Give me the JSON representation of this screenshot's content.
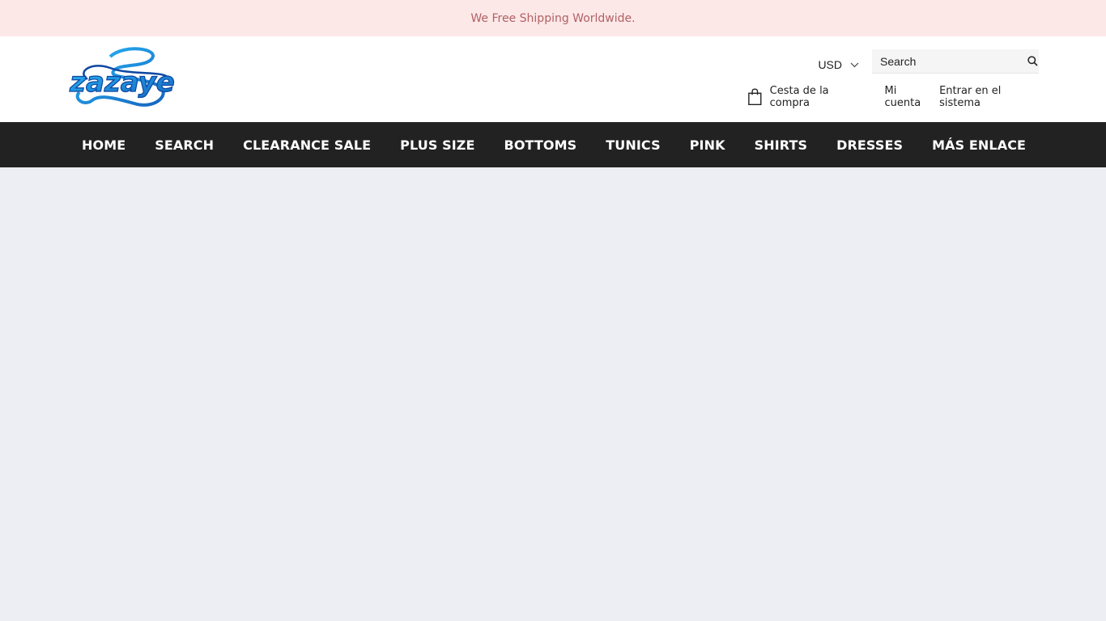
{
  "announcement": "We Free Shipping Worldwide.",
  "logo": {
    "alt": "Zazaye"
  },
  "header": {
    "currency": "USD",
    "search": {
      "placeholder": "Search",
      "value": ""
    },
    "cart_label": "Cesta de la compra",
    "account_label": "Mi cuenta",
    "login_label": "Entrar en el sistema"
  },
  "nav": {
    "items": [
      {
        "label": "HOME"
      },
      {
        "label": "SEARCH"
      },
      {
        "label": "CLEARANCE SALE"
      },
      {
        "label": "PLUS SIZE"
      },
      {
        "label": "BOTTOMS"
      },
      {
        "label": "TUNICS"
      },
      {
        "label": "PINK"
      },
      {
        "label": "SHIRTS"
      },
      {
        "label": "DRESSES"
      },
      {
        "label": "MÁS ENLACE"
      }
    ]
  },
  "colors": {
    "announcement_bg": "#fde8e8",
    "announcement_text": "#b06163",
    "nav_bg": "#222222",
    "page_bg": "#edeef3",
    "logo_blue": "#1e88e5"
  }
}
